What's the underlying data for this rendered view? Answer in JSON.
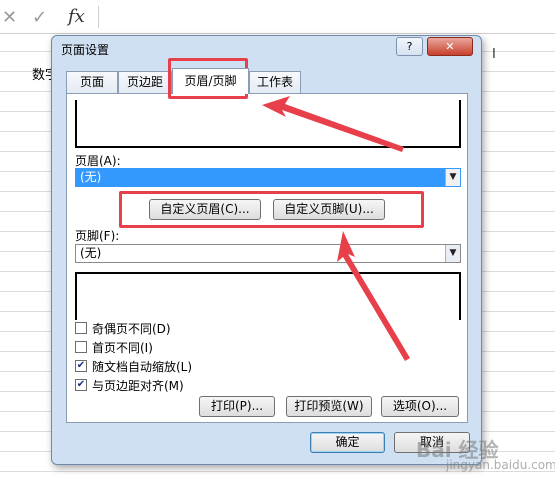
{
  "formula_bar": {
    "cancel_icon": "close-icon",
    "confirm_icon": "check-icon",
    "fx_label": "fx"
  },
  "sheet": {
    "cell_text": "数字"
  },
  "dialog": {
    "title": "页面设置",
    "help_label": "?",
    "close_label": "✕",
    "tabs": [
      "页面",
      "页边距",
      "页眉/页脚",
      "工作表"
    ],
    "active_tab": "页眉/页脚",
    "header_label": "页眉(A):",
    "header_value": "(无)",
    "custom_header_button": "自定义页眉(C)...",
    "custom_footer_button": "自定义页脚(U)...",
    "footer_label": "页脚(F):",
    "footer_value": "(无)",
    "checkboxes": [
      {
        "label": "奇偶页不同(D)",
        "checked": false
      },
      {
        "label": "首页不同(I)",
        "checked": false
      },
      {
        "label": "随文档自动缩放(L)",
        "checked": true
      },
      {
        "label": "与页边距对齐(M)",
        "checked": true
      }
    ],
    "print_button": "打印(P)...",
    "print_preview_button": "打印预览(W)",
    "options_button": "选项(O)...",
    "ok_button": "确定",
    "cancel_button": "取消"
  },
  "annotations": {
    "highlight_color": "#e8404a"
  },
  "watermark": {
    "text": "Bai 经验",
    "sub": "jingyan.baidu.com"
  }
}
